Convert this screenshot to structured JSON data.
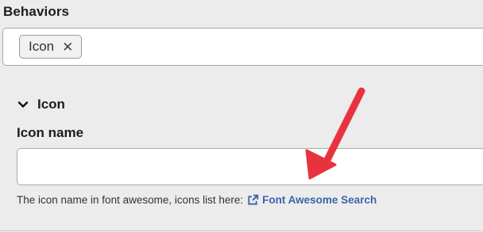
{
  "behaviors": {
    "label": "Behaviors",
    "tags": [
      {
        "label": "Icon",
        "remove_glyph": "✕"
      }
    ]
  },
  "icon_section": {
    "title": "Icon",
    "chevron_icon": "chevron-down-icon",
    "field_label": "Icon name",
    "field_value": "",
    "help_text": "The icon name in font awesome, icons list here:",
    "link_text": "Font Awesome Search",
    "link_icon": "external-link-icon"
  },
  "annotation": {
    "arrow_color": "#e8333f",
    "arrow_icon": "red-arrow"
  },
  "colors": {
    "background": "#ececec",
    "link": "#3c64a8",
    "arrow": "#e8333f"
  }
}
